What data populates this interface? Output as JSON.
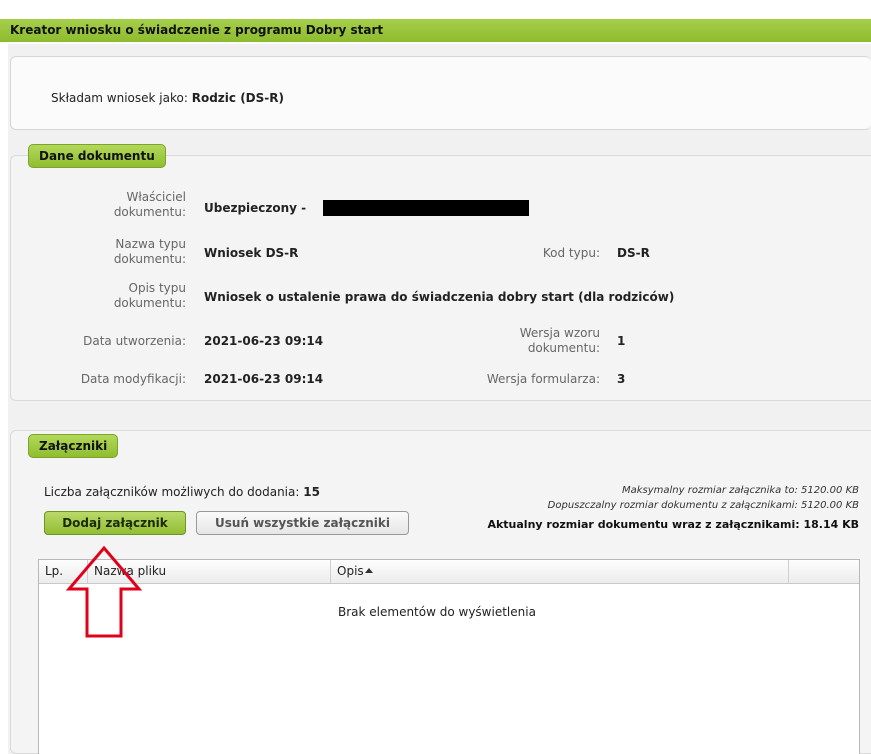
{
  "window": {
    "title": "Kreator wniosku o świadczenie z programu Dobry start"
  },
  "applicant": {
    "prefix": "Składam wniosek jako:",
    "role": "Rodzic (DS-R)"
  },
  "document": {
    "legend": "Dane dokumentu",
    "owner_label": "Właściciel dokumentu:",
    "owner_value": "Ubezpieczony -",
    "type_name_label": "Nazwa typu dokumentu:",
    "type_name_value": "Wniosek DS-R",
    "type_code_label": "Kod typu:",
    "type_code_value": "DS-R",
    "type_desc_label": "Opis typu dokumentu:",
    "type_desc_value": "Wniosek o ustalenie prawa do świadczenia dobry start (dla rodziców)",
    "created_label": "Data utworzenia:",
    "created_value": "2021-06-23 09:14",
    "template_version_label": "Wersja wzoru dokumentu:",
    "template_version_value": "1",
    "modified_label": "Data modyfikacji:",
    "modified_value": "2021-06-23 09:14",
    "form_version_label": "Wersja formularza:",
    "form_version_value": "3"
  },
  "attachments": {
    "legend": "Załączniki",
    "count_label": "Liczba załączników możliwych do dodania:",
    "count_value": "15",
    "max_size": "Maksymalny rozmiar załącznika to: 5120.00 KB",
    "allowed_size": "Dopuszczalny rozmiar dokumentu z załącznikami: 5120.00 KB",
    "current_size": "Aktualny rozmiar dokumentu wraz z załącznikami: 18.14 KB",
    "add_button": "Dodaj załącznik",
    "remove_all_button": "Usuń wszystkie załączniki",
    "columns": [
      "Lp.",
      "Nazwa pliku",
      "Opis"
    ],
    "empty_text": "Brak elementów do wyświetlenia"
  },
  "colors": {
    "accent": "#8dbb2e",
    "arrow": "#e0001a"
  }
}
